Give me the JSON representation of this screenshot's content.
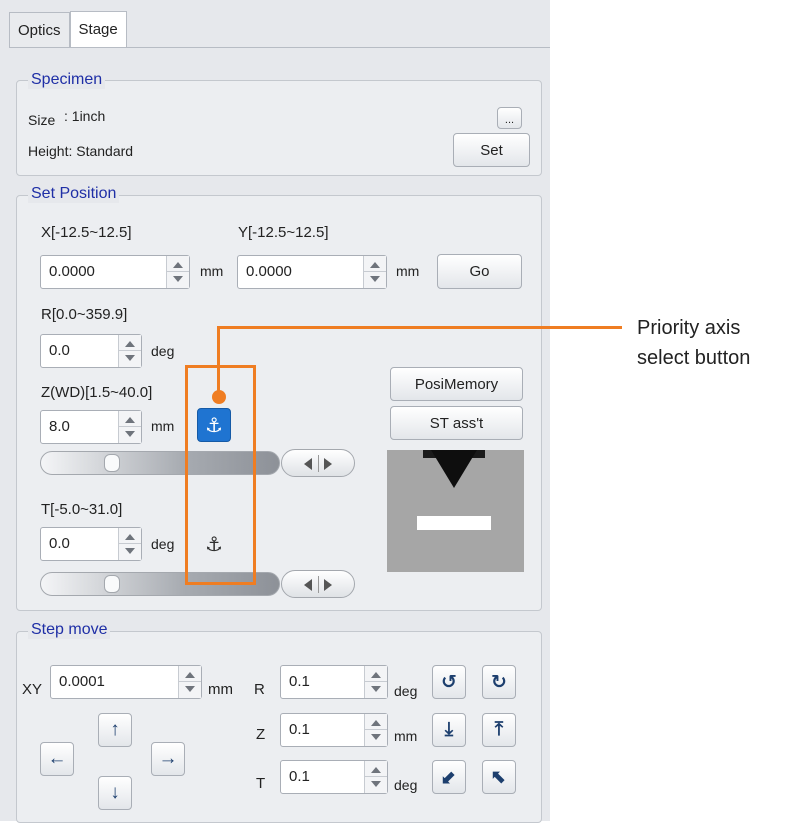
{
  "tabs": [
    {
      "label": "Optics"
    },
    {
      "label": "Stage"
    }
  ],
  "specimen": {
    "title": "Specimen",
    "size_label": "Size",
    "size_value": ": 1inch",
    "height_label": "Height: Standard",
    "more_label": "...",
    "set_label": "Set"
  },
  "set_position": {
    "title": "Set Position",
    "x_range": "X[-12.5~12.5]",
    "y_range": "Y[-12.5~12.5]",
    "x_value": "0.0000",
    "y_value": "0.0000",
    "mm": "mm",
    "go_label": "Go",
    "r_range": "R[0.0~359.9]",
    "r_value": "0.0",
    "deg": "deg",
    "z_range": "Z(WD)[1.5~40.0]",
    "z_value": "8.0",
    "t_range": "T[-5.0~31.0]",
    "t_value": "0.0",
    "posimemory_label": "PosiMemory",
    "stassist_label": "ST ass't",
    "z_slider_level": 0.28,
    "t_slider_level": 0.28,
    "z_priority_active": true,
    "t_priority_active": false
  },
  "step_move": {
    "title": "Step move",
    "xy_label": "XY",
    "xy_value": "0.0001",
    "xy_unit": "mm",
    "r_label": "R",
    "r_value": "0.1",
    "r_unit": "deg",
    "z_label": "Z",
    "z_value": "0.1",
    "z_unit": "mm",
    "t_label": "T",
    "t_value": "0.1",
    "t_unit": "deg"
  },
  "annotation": {
    "line1": "Priority axis",
    "line2": "select button"
  },
  "colors": {
    "accent_orange": "#ef7d22",
    "priority_active_blue": "#1f74d1",
    "group_title_blue": "#1f2fa6"
  },
  "icons": {
    "priority_axis": "anchor-icon",
    "rotate_ccw": "rotate-ccw-icon",
    "rotate_cw": "rotate-cw-icon",
    "z_down": "z-down-icon",
    "z_up": "z-up-icon",
    "tilt_down": "tilt-down-icon",
    "tilt_up": "tilt-up-icon"
  }
}
